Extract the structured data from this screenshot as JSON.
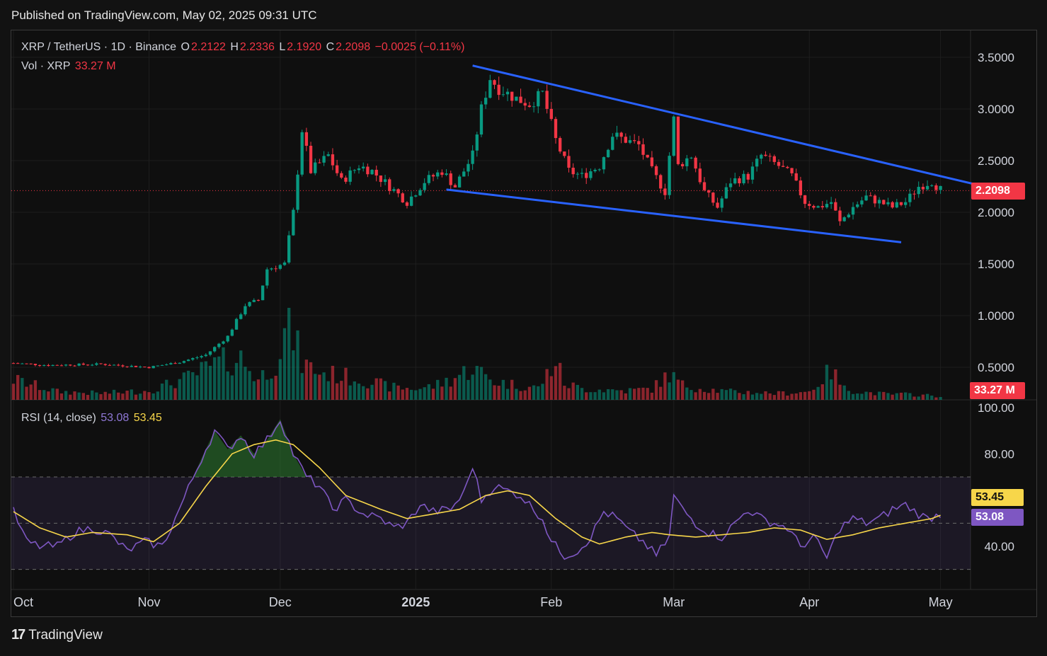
{
  "header": {
    "published": "Published on TradingView.com, May 02, 2025 09:31 UTC"
  },
  "legend": {
    "symbol": "XRP / TetherUS · 1D · Binance",
    "o_label": "O",
    "o_value": "2.2122",
    "h_label": "H",
    "h_value": "2.2336",
    "l_label": "L",
    "l_value": "2.1920",
    "c_label": "C",
    "c_value": "2.2098",
    "change": "−0.0025 (−0.11%)",
    "vol_label": "Vol · XRP",
    "vol_value": "33.27 M"
  },
  "rsi_legend": {
    "label": "RSI (14, close)",
    "rsi_value": "53.08",
    "ma_value": "53.45"
  },
  "tags": {
    "price": "2.2098",
    "volume": "33.27 M",
    "rsi_ma": "53.45",
    "rsi": "53.08"
  },
  "footer": {
    "brand": "TradingView"
  },
  "colors": {
    "up": "#089981",
    "down": "#f23645",
    "trend": "#2962ff",
    "rsi": "#7e57c2",
    "rsi_ma": "#f7d64a"
  },
  "chart_data": {
    "type": "candlestick",
    "price_axis": {
      "ticks": [
        "3.5000",
        "3.0000",
        "2.5000",
        "2.0000",
        "1.5000",
        "1.0000",
        "0.5000"
      ],
      "ylim": [
        0.4,
        3.6
      ]
    },
    "rsi_axis": {
      "ticks": [
        "100.00",
        "80.00",
        "40.00"
      ],
      "ylim": [
        20,
        100
      ],
      "bands": [
        30,
        70
      ]
    },
    "x_ticks": [
      "Oct",
      "Nov",
      "Dec",
      "2025",
      "Feb",
      "Mar",
      "Apr",
      "May"
    ],
    "x_tick_days": [
      0,
      31,
      61,
      92,
      123,
      151,
      182,
      212
    ],
    "days_total": 220,
    "price_anchors": [
      [
        0,
        0.54
      ],
      [
        8,
        0.52
      ],
      [
        20,
        0.53
      ],
      [
        31,
        0.5
      ],
      [
        38,
        0.55
      ],
      [
        44,
        0.62
      ],
      [
        49,
        0.8
      ],
      [
        53,
        1.1
      ],
      [
        56,
        1.15
      ],
      [
        58,
        1.45
      ],
      [
        62,
        1.5
      ],
      [
        64,
        2.0
      ],
      [
        66,
        2.8
      ],
      [
        68,
        2.4
      ],
      [
        72,
        2.55
      ],
      [
        75,
        2.3
      ],
      [
        79,
        2.45
      ],
      [
        82,
        2.4
      ],
      [
        86,
        2.25
      ],
      [
        90,
        2.1
      ],
      [
        94,
        2.3
      ],
      [
        98,
        2.4
      ],
      [
        101,
        2.25
      ],
      [
        105,
        2.55
      ],
      [
        107,
        3.0
      ],
      [
        109,
        3.3
      ],
      [
        111,
        3.2
      ],
      [
        115,
        3.1
      ],
      [
        118,
        3.05
      ],
      [
        121,
        3.15
      ],
      [
        124,
        2.7
      ],
      [
        127,
        2.4
      ],
      [
        130,
        2.35
      ],
      [
        134,
        2.45
      ],
      [
        137,
        2.75
      ],
      [
        140,
        2.7
      ],
      [
        143,
        2.65
      ],
      [
        146,
        2.4
      ],
      [
        149,
        2.2
      ],
      [
        151,
        2.9
      ],
      [
        152,
        2.45
      ],
      [
        155,
        2.55
      ],
      [
        158,
        2.2
      ],
      [
        161,
        2.05
      ],
      [
        164,
        2.3
      ],
      [
        168,
        2.35
      ],
      [
        171,
        2.55
      ],
      [
        175,
        2.45
      ],
      [
        178,
        2.35
      ],
      [
        181,
        2.1
      ],
      [
        184,
        2.05
      ],
      [
        187,
        2.1
      ],
      [
        189,
        1.9
      ],
      [
        192,
        2.05
      ],
      [
        195,
        2.15
      ],
      [
        198,
        2.1
      ],
      [
        201,
        2.05
      ],
      [
        204,
        2.1
      ],
      [
        207,
        2.25
      ],
      [
        210,
        2.3
      ],
      [
        212,
        2.22
      ]
    ],
    "volume_anchors": [
      [
        0,
        22
      ],
      [
        10,
        9
      ],
      [
        20,
        7
      ],
      [
        31,
        10
      ],
      [
        40,
        24
      ],
      [
        47,
        40
      ],
      [
        52,
        45
      ],
      [
        56,
        22
      ],
      [
        60,
        42
      ],
      [
        63,
        85
      ],
      [
        66,
        40
      ],
      [
        70,
        30
      ],
      [
        75,
        26
      ],
      [
        80,
        22
      ],
      [
        86,
        14
      ],
      [
        92,
        12
      ],
      [
        96,
        15
      ],
      [
        100,
        22
      ],
      [
        105,
        35
      ],
      [
        110,
        20
      ],
      [
        115,
        16
      ],
      [
        120,
        13
      ],
      [
        124,
        42
      ],
      [
        126,
        18
      ],
      [
        130,
        12
      ],
      [
        140,
        10
      ],
      [
        146,
        12
      ],
      [
        150,
        28
      ],
      [
        153,
        16
      ],
      [
        158,
        12
      ],
      [
        163,
        9
      ],
      [
        170,
        8
      ],
      [
        175,
        7
      ],
      [
        182,
        9
      ],
      [
        187,
        32
      ],
      [
        190,
        12
      ],
      [
        195,
        8
      ],
      [
        200,
        6
      ],
      [
        205,
        6
      ],
      [
        212,
        4
      ]
    ],
    "volume_max": 100,
    "rsi_anchors": [
      [
        0,
        55
      ],
      [
        3,
        42
      ],
      [
        6,
        40
      ],
      [
        10,
        40
      ],
      [
        14,
        46
      ],
      [
        18,
        48
      ],
      [
        22,
        45
      ],
      [
        26,
        38
      ],
      [
        30,
        42
      ],
      [
        34,
        40
      ],
      [
        37,
        52
      ],
      [
        40,
        65
      ],
      [
        43,
        78
      ],
      [
        46,
        90
      ],
      [
        49,
        82
      ],
      [
        52,
        88
      ],
      [
        55,
        80
      ],
      [
        58,
        86
      ],
      [
        61,
        95
      ],
      [
        64,
        80
      ],
      [
        67,
        70
      ],
      [
        70,
        66
      ],
      [
        73,
        56
      ],
      [
        76,
        60
      ],
      [
        80,
        54
      ],
      [
        84,
        52
      ],
      [
        87,
        48
      ],
      [
        90,
        50
      ],
      [
        93,
        58
      ],
      [
        96,
        55
      ],
      [
        100,
        56
      ],
      [
        103,
        63
      ],
      [
        105,
        75
      ],
      [
        107,
        60
      ],
      [
        110,
        66
      ],
      [
        113,
        64
      ],
      [
        116,
        62
      ],
      [
        119,
        56
      ],
      [
        121,
        52
      ],
      [
        123,
        42
      ],
      [
        126,
        36
      ],
      [
        129,
        38
      ],
      [
        132,
        44
      ],
      [
        135,
        55
      ],
      [
        138,
        52
      ],
      [
        141,
        46
      ],
      [
        144,
        42
      ],
      [
        147,
        36
      ],
      [
        150,
        44
      ],
      [
        151,
        62
      ],
      [
        153,
        56
      ],
      [
        156,
        50
      ],
      [
        159,
        46
      ],
      [
        162,
        44
      ],
      [
        165,
        50
      ],
      [
        168,
        56
      ],
      [
        171,
        52
      ],
      [
        174,
        50
      ],
      [
        177,
        48
      ],
      [
        180,
        40
      ],
      [
        183,
        44
      ],
      [
        186,
        35
      ],
      [
        189,
        48
      ],
      [
        192,
        52
      ],
      [
        195,
        50
      ],
      [
        198,
        52
      ],
      [
        201,
        56
      ],
      [
        204,
        58
      ],
      [
        207,
        54
      ],
      [
        209,
        52
      ],
      [
        212,
        54
      ]
    ],
    "rsi_ma_anchors": [
      [
        0,
        55
      ],
      [
        6,
        48
      ],
      [
        12,
        44
      ],
      [
        18,
        46
      ],
      [
        26,
        45
      ],
      [
        32,
        42
      ],
      [
        38,
        50
      ],
      [
        44,
        66
      ],
      [
        50,
        80
      ],
      [
        55,
        84
      ],
      [
        60,
        86
      ],
      [
        64,
        84
      ],
      [
        70,
        74
      ],
      [
        76,
        62
      ],
      [
        84,
        56
      ],
      [
        90,
        52
      ],
      [
        96,
        54
      ],
      [
        102,
        56
      ],
      [
        108,
        62
      ],
      [
        113,
        64
      ],
      [
        118,
        62
      ],
      [
        124,
        52
      ],
      [
        130,
        44
      ],
      [
        134,
        41
      ],
      [
        140,
        44
      ],
      [
        146,
        46
      ],
      [
        150,
        45
      ],
      [
        156,
        44
      ],
      [
        162,
        45
      ],
      [
        168,
        46
      ],
      [
        174,
        48
      ],
      [
        180,
        47
      ],
      [
        186,
        43
      ],
      [
        192,
        45
      ],
      [
        198,
        48
      ],
      [
        204,
        50
      ],
      [
        210,
        52
      ],
      [
        212,
        53.45
      ]
    ],
    "trendlines": [
      {
        "name": "upper",
        "from": [
          105,
          3.42
        ],
        "to": [
          220,
          2.27
        ]
      },
      {
        "name": "lower",
        "from": [
          99,
          2.22
        ],
        "to": [
          203,
          1.71
        ]
      }
    ],
    "last_price": 2.2098,
    "last_volume": "33.27 M",
    "rsi_last": 53.08,
    "rsi_ma_last": 53.45
  }
}
